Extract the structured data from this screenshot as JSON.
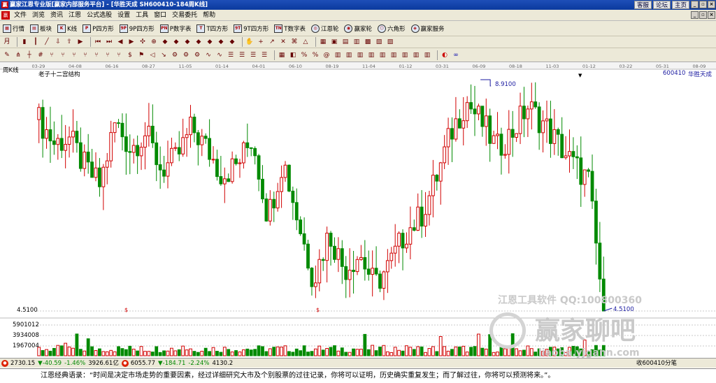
{
  "window": {
    "title": "赢家江恩专业版[赢家内部服务平台] - [华胜天成  SH600410-184周K线]",
    "top_links": [
      "客服",
      "论坛",
      "主页"
    ],
    "buttons": [
      "_",
      "▫",
      "×"
    ]
  },
  "menu": {
    "logo": "赢",
    "items": [
      "文件",
      "浏览",
      "资讯",
      "江恩",
      "公式选股",
      "设置",
      "工具",
      "窗口",
      "交易委托",
      "帮助"
    ]
  },
  "toolbar1": [
    {
      "icon": "grid-icon",
      "label": "行情"
    },
    {
      "icon": "block-icon",
      "label": "板块"
    },
    {
      "icon": "kline-icon",
      "label": "K线"
    },
    {
      "icon": "p-icon",
      "label": "P四方形"
    },
    {
      "icon": "9p-icon",
      "label": "9P四方形"
    },
    {
      "icon": "p-table-icon",
      "label": "P数字表"
    },
    {
      "icon": "t-icon",
      "label": "T四方形"
    },
    {
      "icon": "9t-icon",
      "label": "9T四方形"
    },
    {
      "icon": "tn-icon",
      "label": "T数字表"
    },
    {
      "icon": "gann-wheel-icon",
      "label": "江恩轮"
    },
    {
      "icon": "winner-wheel-icon",
      "label": "赢家轮"
    },
    {
      "icon": "hexagon-icon",
      "label": "六角形"
    },
    {
      "icon": "service-icon",
      "label": "赢家服务"
    }
  ],
  "chart": {
    "period_label": "周K线",
    "study_label": "老子十二宫结构",
    "stock_code": "600410",
    "stock_name": "华胜天成",
    "high_label": "8.9100",
    "low_label": "4.5100",
    "level_label": "4.5100",
    "vol_ticks": [
      "5901012",
      "3934008",
      "1967004"
    ],
    "dates": [
      "03-29",
      "04-08",
      "06-16",
      "08-27",
      "11-05",
      "01-14",
      "04-01",
      "06-10",
      "08-19",
      "11-04",
      "01-12",
      "03-31",
      "06-09",
      "08-18",
      "11-03",
      "01-12",
      "03-22",
      "05-31",
      "08-09"
    ],
    "watermark1": "江恩工具软件 QQ:100800360",
    "watermark2": "赢家聊吧",
    "watermark3": "liaoba.yjgann.com",
    "colors": {
      "up": "#d10000",
      "down": "#008a00",
      "grid": "#c8c8c8",
      "label": "#1a1aa0"
    }
  },
  "chart_data": {
    "type": "candlestick",
    "title": "",
    "xlabel": "",
    "ylabel": "",
    "ylim": [
      4.51,
      8.91
    ],
    "x": [
      "03-29",
      "04-08",
      "06-16",
      "08-27",
      "11-05",
      "01-14",
      "04-01",
      "06-10",
      "08-19",
      "11-04",
      "01-12",
      "03-31",
      "06-09",
      "08-18",
      "11-03",
      "01-12",
      "03-22",
      "05-31",
      "08-09"
    ],
    "series": [
      {
        "values": [
          8.15,
          7.7,
          7.8,
          7.25,
          6.9,
          8.1,
          7.6,
          7.9,
          7.2,
          7.4,
          8.0,
          7.6,
          7.1,
          7.3,
          7.8,
          6.3,
          7.4,
          6.2,
          5.1,
          6.0,
          5.3,
          5.6,
          5.0,
          5.4,
          6.0,
          6.3,
          7.0,
          7.9,
          8.5,
          8.1,
          7.6,
          7.9,
          8.4,
          8.1,
          7.7,
          7.3,
          7.0,
          4.51
        ]
      }
    ],
    "marks": {
      "high": 8.91,
      "low": 4.51
    },
    "volume_ticks": [
      5901012,
      3934008,
      1967004
    ]
  },
  "statusbar": {
    "sh_index": "2730.15",
    "sh_change": "▼-40.59",
    "sh_pct": "-1.46%",
    "sh_amount": "3926.61亿",
    "sz_index": "6055.77",
    "sz_change": "▼-184.71",
    "sz_pct": "-2.24%",
    "sz_amount": "4130.2",
    "right_text": "收600410分笔"
  },
  "quote": "江恩经典语录：“时间是决定市场走势的重要因素，经过详细研究大市及个别股票的过往记录，你将可以证明，历史确实重复发生；而了解过往，你将可以预测将来。”。"
}
